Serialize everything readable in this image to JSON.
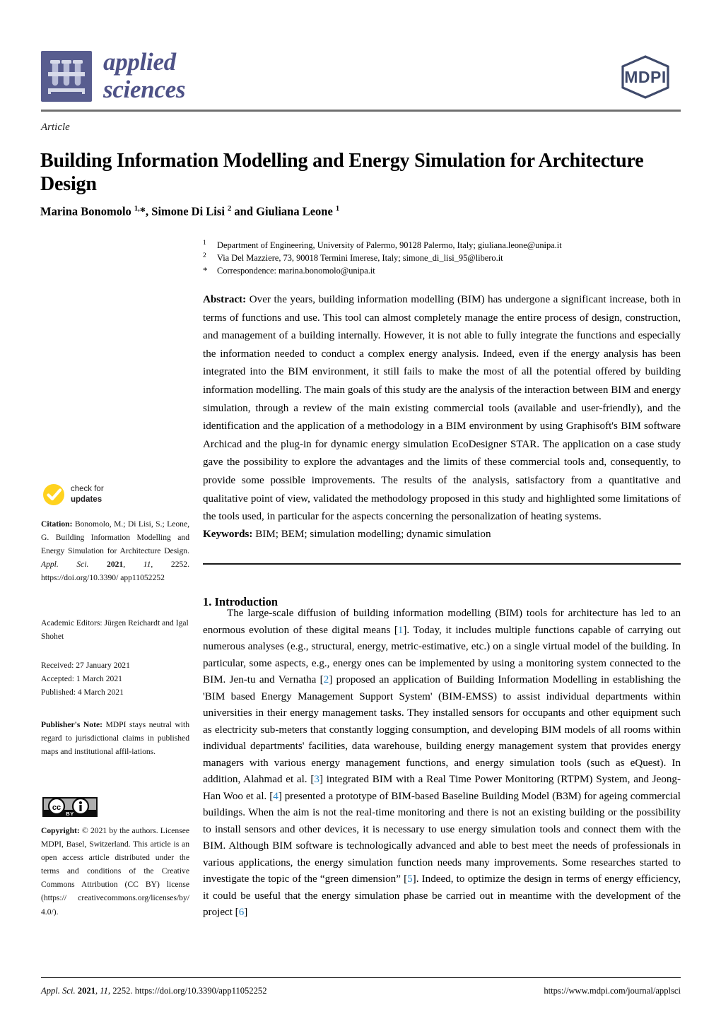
{
  "journal": {
    "name_line1": "applied",
    "name_line2": "sciences",
    "publisher_logo_text": "MDPI",
    "logo_icon": "test-tube-rack-icon"
  },
  "article": {
    "type": "Article",
    "title": "Building Information Modelling and Energy Simulation for Architecture Design",
    "authors_html": "Marina Bonomolo <sup>1,</sup>*, Simone Di Lisi <sup>2</sup> and Giuliana Leone <sup>1</sup>"
  },
  "affiliations": [
    {
      "marker": "1",
      "text": "Department of Engineering, University of Palermo, 90128 Palermo, Italy; giuliana.leone@unipa.it"
    },
    {
      "marker": "2",
      "text": "Via Del Mazziere, 73, 90018 Termini Imerese, Italy; simone_di_lisi_95@libero.it"
    },
    {
      "marker": "*",
      "text": "Correspondence: marina.bonomolo@unipa.it"
    }
  ],
  "abstract": {
    "label": "Abstract:",
    "text": "Over the years, building information modelling (BIM) has undergone a significant increase, both in terms of functions and use. This tool can almost completely manage the entire process of design, construction, and management of a building internally. However, it is not able to fully integrate the functions and especially the information needed to conduct a complex energy analysis. Indeed, even if the energy analysis has been integrated into the BIM environment, it still fails to make the most of all the potential offered by building information modelling. The main goals of this study are the analysis of the interaction between BIM and energy simulation, through a review of the main existing commercial tools (available and user-friendly), and the identification and the application of a methodology in a BIM environment by using Graphisoft's BIM software Archicad and the plug-in for dynamic energy simulation EcoDesigner STAR. The application on a case study gave the possibility to explore the advantages and the limits of these commercial tools and, consequently, to provide some possible improvements. The results of the analysis, satisfactory from a quantitative and qualitative point of view, validated the methodology proposed in this study and highlighted some limitations of the tools used, in particular for the aspects concerning the personalization of heating systems."
  },
  "keywords": {
    "label": "Keywords:",
    "text": "BIM; BEM; simulation modelling; dynamic simulation"
  },
  "introduction": {
    "heading": "1. Introduction",
    "paragraph_parts": [
      {
        "type": "text",
        "value": "The large-scale diffusion of building information modelling (BIM) tools for architecture has led to an enormous evolution of these digital means ["
      },
      {
        "type": "ref",
        "value": "1"
      },
      {
        "type": "text",
        "value": "]. Today, it includes multiple functions capable of carrying out numerous analyses (e.g., structural, energy, metric-estimative, etc.) on a single virtual model of the building. In particular, some aspects, e.g., energy ones can be implemented by using a monitoring system connected to the BIM. Jen-tu and Vernatha ["
      },
      {
        "type": "ref",
        "value": "2"
      },
      {
        "type": "text",
        "value": "] proposed an application of Building Information Modelling in establishing the 'BIM based Energy Management Support System' (BIM-EMSS) to assist individual departments within universities in their energy management tasks. They installed sensors for occupants and other equipment such as electricity sub-meters that constantly logging consumption, and developing BIM models of all rooms within individual departments' facilities, data warehouse, building energy management system that provides energy managers with various energy management functions, and energy simulation tools (such as eQuest). In addition, Alahmad et al. ["
      },
      {
        "type": "ref",
        "value": "3"
      },
      {
        "type": "text",
        "value": "] integrated BIM with a Real Time Power Monitoring (RTPM) System, and Jeong-Han Woo et al. ["
      },
      {
        "type": "ref",
        "value": "4"
      },
      {
        "type": "text",
        "value": "] presented a prototype of BIM-based Baseline Building Model (B3M) for ageing commercial buildings. When the aim is not the real-time monitoring and there is not an existing building or the possibility to install sensors and other devices, it is necessary to use energy simulation tools and connect them with the BIM. Although BIM software is technologically advanced and able to best meet the needs of professionals in various applications, the energy simulation function needs many improvements. Some researches started to investigate the topic of the “green dimension” ["
      },
      {
        "type": "ref",
        "value": "5"
      },
      {
        "type": "text",
        "value": "]. Indeed, to optimize the design in terms of energy efficiency, it could be useful that the energy simulation phase be carried out in meantime with the development of the project ["
      },
      {
        "type": "ref",
        "value": "6"
      },
      {
        "type": "text",
        "value": "]"
      }
    ]
  },
  "sidebar": {
    "check_for_updates": {
      "line1": "check for",
      "line2": "updates",
      "icon": "checkmark-circle-icon"
    },
    "citation": {
      "label": "Citation:",
      "text_before_italic": " Bonomolo, M.; Di Lisi, S.; Leone, G. Building Information Modelling and Energy Simulation for Architecture Design. ",
      "journal_italic": "Appl. Sci.",
      "year_bold": " 2021",
      "volume_italic": "11",
      "rest": ", 2252. https://doi.org/10.3390/ app11052252"
    },
    "academic_editors": "Academic Editors: Jürgen Reichardt and Igal Shohet",
    "dates": [
      "Received: 27 January 2021",
      "Accepted: 1 March 2021",
      "Published: 4 March 2021"
    ],
    "publisher_note": {
      "label": "Publisher's Note:",
      "text": " MDPI stays neutral with regard to jurisdictional claims in published maps and institutional affil-iations."
    },
    "cc_badge": {
      "cc_text": "cc",
      "by_text": "BY",
      "icon": "creative-commons-by-icon"
    },
    "copyright": {
      "label": "Copyright:",
      "text": " © 2021 by the authors. Licensee MDPI, Basel, Switzerland. This article is an open access article distributed under the terms and conditions of the Creative Commons Attribution (CC BY) license (https:// creativecommons.org/licenses/by/ 4.0/)."
    }
  },
  "footer": {
    "left_italic_1": "Appl. Sci.",
    "left_bold_year": " 2021",
    "left_italic_vol": "11",
    "left_rest": ", 2252. https://doi.org/10.3390/app11052252",
    "right": "https://www.mdpi.com/journal/applsci"
  },
  "colors": {
    "journal_purple": "#4e5287",
    "logo_square": "#585d8f",
    "mdpi_navy": "#3f4a6b",
    "reference_blue": "#2b86c5",
    "check_yellow": "#ffd21e",
    "rule_gray": "#6f6f6f"
  }
}
